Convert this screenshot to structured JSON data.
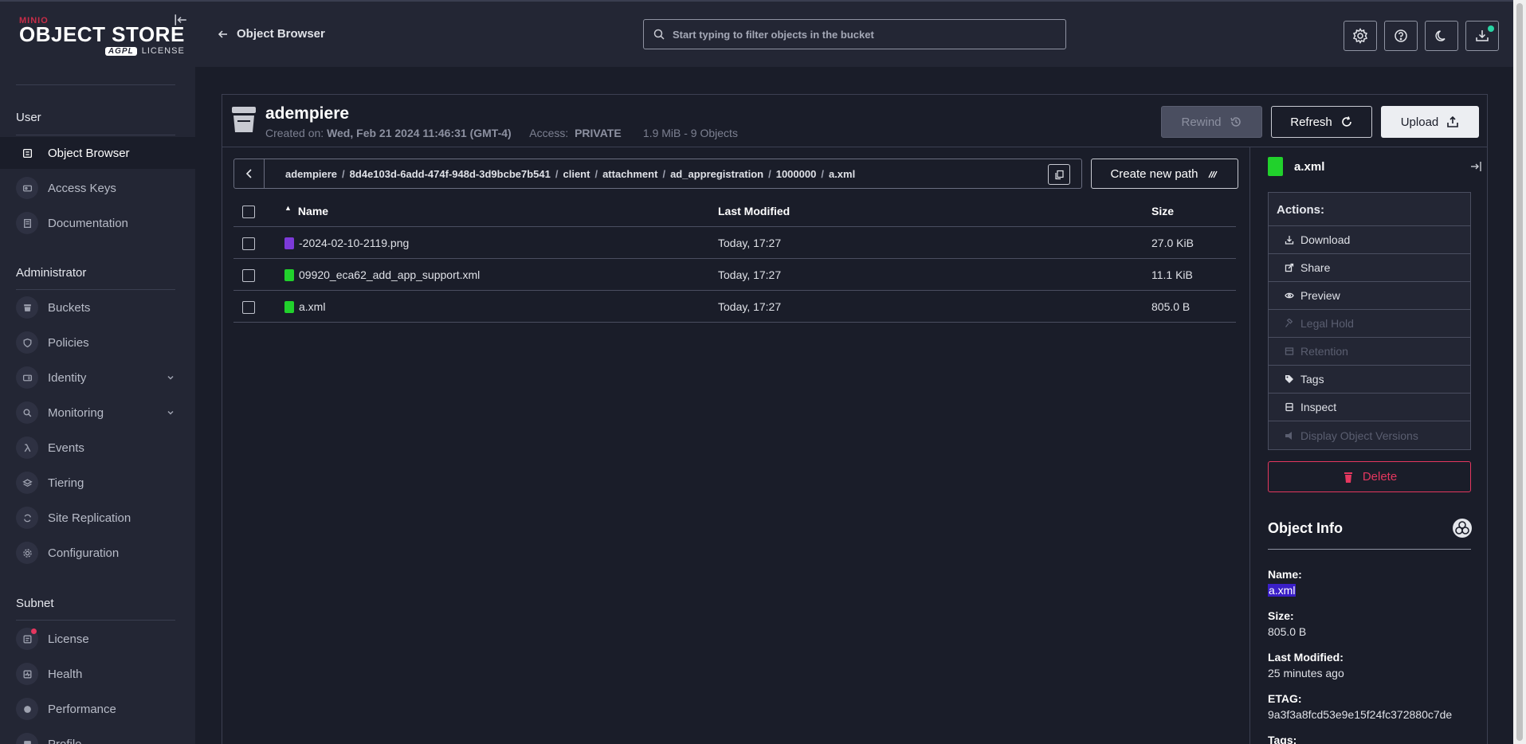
{
  "logo": {
    "brand": "MINIO",
    "product": "OBJECT STORE",
    "badge": "AGPL",
    "license": "LICENSE"
  },
  "sidebar": {
    "user_section": "User",
    "admin_section": "Administrator",
    "subnet_section": "Subnet",
    "user_items": [
      {
        "label": "Object Browser",
        "icon": "object-browser-icon"
      },
      {
        "label": "Access Keys",
        "icon": "key-icon"
      },
      {
        "label": "Documentation",
        "icon": "document-icon"
      }
    ],
    "admin_items": [
      {
        "label": "Buckets",
        "icon": "bucket-icon"
      },
      {
        "label": "Policies",
        "icon": "shield-icon"
      },
      {
        "label": "Identity",
        "icon": "id-card-icon"
      },
      {
        "label": "Monitoring",
        "icon": "magnifier-icon"
      },
      {
        "label": "Events",
        "icon": "lambda-icon"
      },
      {
        "label": "Tiering",
        "icon": "layers-icon"
      },
      {
        "label": "Site Replication",
        "icon": "replication-icon"
      },
      {
        "label": "Configuration",
        "icon": "gear-icon"
      }
    ],
    "subnet_items": [
      {
        "label": "License",
        "icon": "license-icon"
      },
      {
        "label": "Health",
        "icon": "health-icon"
      },
      {
        "label": "Performance",
        "icon": "gauge-icon"
      },
      {
        "label": "Profile",
        "icon": "profile-icon"
      }
    ]
  },
  "header": {
    "back_label": "Object Browser",
    "search_placeholder": "Start typing to filter objects in the bucket"
  },
  "bucket": {
    "name": "adempiere",
    "created_label": "Created on:",
    "created_value": "Wed, Feb 21 2024 11:46:31 (GMT-4)",
    "access_label": "Access:",
    "access_value": "PRIVATE",
    "stats": "1.9 MiB - 9 Objects",
    "rewind_label": "Rewind",
    "refresh_label": "Refresh",
    "upload_label": "Upload"
  },
  "breadcrumb": {
    "segments": [
      "adempiere",
      "8d4e103d-6add-474f-948d-3d9bcbe7b541",
      "client",
      "attachment",
      "ad_appregistration",
      "1000000",
      "a.xml"
    ],
    "new_path_label": "Create new path"
  },
  "table": {
    "columns": [
      "Name",
      "Last Modified",
      "Size"
    ],
    "rows": [
      {
        "name": "-2024-02-10-2119.png",
        "type": "png",
        "modified": "Today, 17:27",
        "size": "27.0 KiB"
      },
      {
        "name": "09920_eca62_add_app_support.xml",
        "type": "xml",
        "modified": "Today, 17:27",
        "size": "11.1 KiB"
      },
      {
        "name": "a.xml",
        "type": "xml",
        "modified": "Today, 17:27",
        "size": "805.0 B"
      }
    ]
  },
  "object_panel": {
    "title": "a.xml",
    "actions_label": "Actions:",
    "actions": [
      {
        "label": "Download",
        "disabled": false
      },
      {
        "label": "Share",
        "disabled": false
      },
      {
        "label": "Preview",
        "disabled": false
      },
      {
        "label": "Legal Hold",
        "disabled": true
      },
      {
        "label": "Retention",
        "disabled": true
      },
      {
        "label": "Tags",
        "disabled": false
      },
      {
        "label": "Inspect",
        "disabled": false
      },
      {
        "label": "Display Object Versions",
        "disabled": true
      }
    ],
    "delete_label": "Delete",
    "info_title": "Object Info",
    "name_label": "Name:",
    "name_value": "a.xml",
    "size_label": "Size:",
    "size_value": "805.0 B",
    "modified_label": "Last Modified:",
    "modified_value": "25 minutes ago",
    "etag_label": "ETAG:",
    "etag_value": "9a3f3a8fcd53e9e15f24fc372880c7de",
    "tags_label": "Tags:"
  }
}
